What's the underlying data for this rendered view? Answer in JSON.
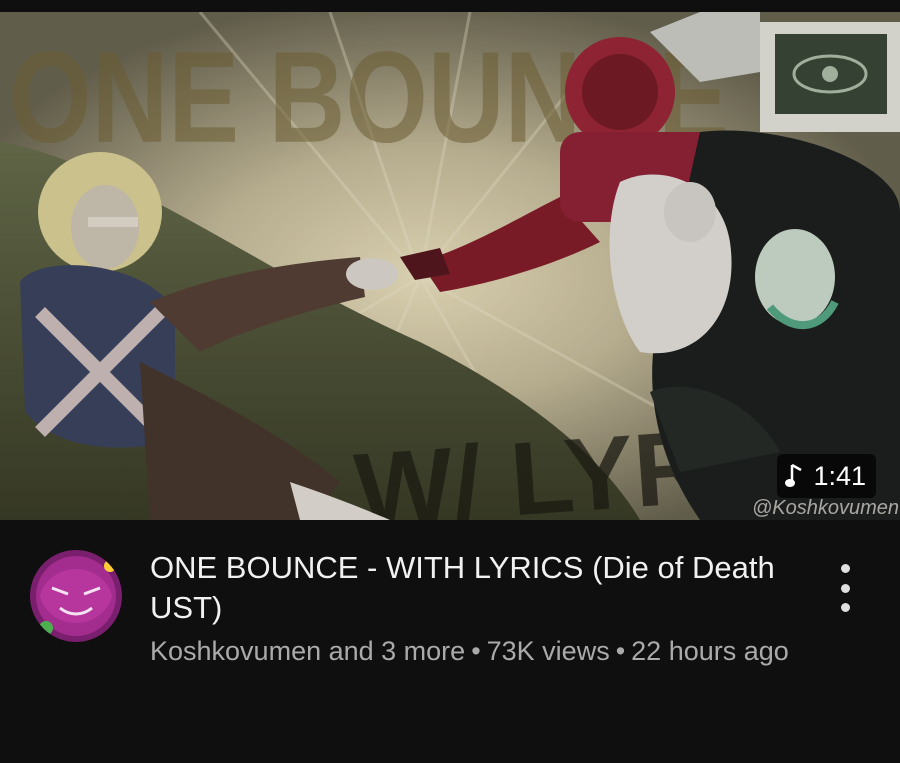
{
  "video": {
    "title": "ONE BOUNCE - WITH LYRICS (Die of Death UST)",
    "channel": "Koshkovumen and 3 more",
    "views": "73K views",
    "age": "22 hours ago",
    "separator": "•",
    "duration": "1:41",
    "duration_icon": "music-note-icon"
  },
  "thumbnail": {
    "overlay_text_top": "ONE BOUNCE",
    "overlay_text_bottom": "W/ LYRICS",
    "watermark": "@Koshkovumen"
  },
  "menu": {
    "icon": "more-vert-icon"
  },
  "colors": {
    "background": "#0f0f0f",
    "title": "#f1f1f1",
    "secondary_text": "#aaaaaa",
    "avatar_bg": "#7a1f6e",
    "badge_bg": "#000000"
  }
}
